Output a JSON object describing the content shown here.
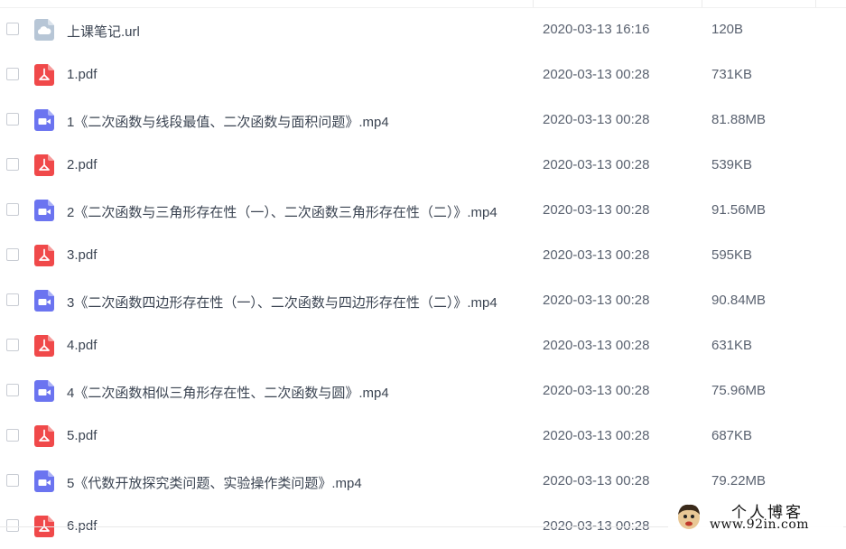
{
  "files": [
    {
      "icon": "cloud-link-icon",
      "name": "上课笔记.url",
      "date": "2020-03-13 16:16",
      "size": "120B"
    },
    {
      "icon": "pdf-icon",
      "name": "1.pdf",
      "date": "2020-03-13 00:28",
      "size": "731KB"
    },
    {
      "icon": "video-icon",
      "name": "1《二次函数与线段最值、二次函数与面积问题》.mp4",
      "date": "2020-03-13 00:28",
      "size": "81.88MB"
    },
    {
      "icon": "pdf-icon",
      "name": "2.pdf",
      "date": "2020-03-13 00:28",
      "size": "539KB"
    },
    {
      "icon": "video-icon",
      "name": "2《二次函数与三角形存在性（一）、二次函数三角形存在性（二）》.mp4",
      "date": "2020-03-13 00:28",
      "size": "91.56MB"
    },
    {
      "icon": "pdf-icon",
      "name": "3.pdf",
      "date": "2020-03-13 00:28",
      "size": "595KB"
    },
    {
      "icon": "video-icon",
      "name": "3《二次函数四边形存在性（一）、二次函数与四边形存在性（二）》.mp4",
      "date": "2020-03-13 00:28",
      "size": "90.84MB"
    },
    {
      "icon": "pdf-icon",
      "name": "4.pdf",
      "date": "2020-03-13 00:28",
      "size": "631KB"
    },
    {
      "icon": "video-icon",
      "name": "4《二次函数相似三角形存在性、二次函数与圆》.mp4",
      "date": "2020-03-13 00:28",
      "size": "75.96MB"
    },
    {
      "icon": "pdf-icon",
      "name": "5.pdf",
      "date": "2020-03-13 00:28",
      "size": "687KB"
    },
    {
      "icon": "video-icon",
      "name": "5《代数开放探究类问题、实验操作类问题》.mp4",
      "date": "2020-03-13 00:28",
      "size": "79.22MB"
    },
    {
      "icon": "pdf-icon",
      "name": "6.pdf",
      "date": "2020-03-13 00:28",
      "size": ""
    }
  ],
  "watermark": {
    "title": "个人博客",
    "url": "www.92in.com"
  },
  "colors": {
    "pdf": "#f0494a",
    "video": "#6b74f0",
    "link": "#b7c6d6"
  }
}
